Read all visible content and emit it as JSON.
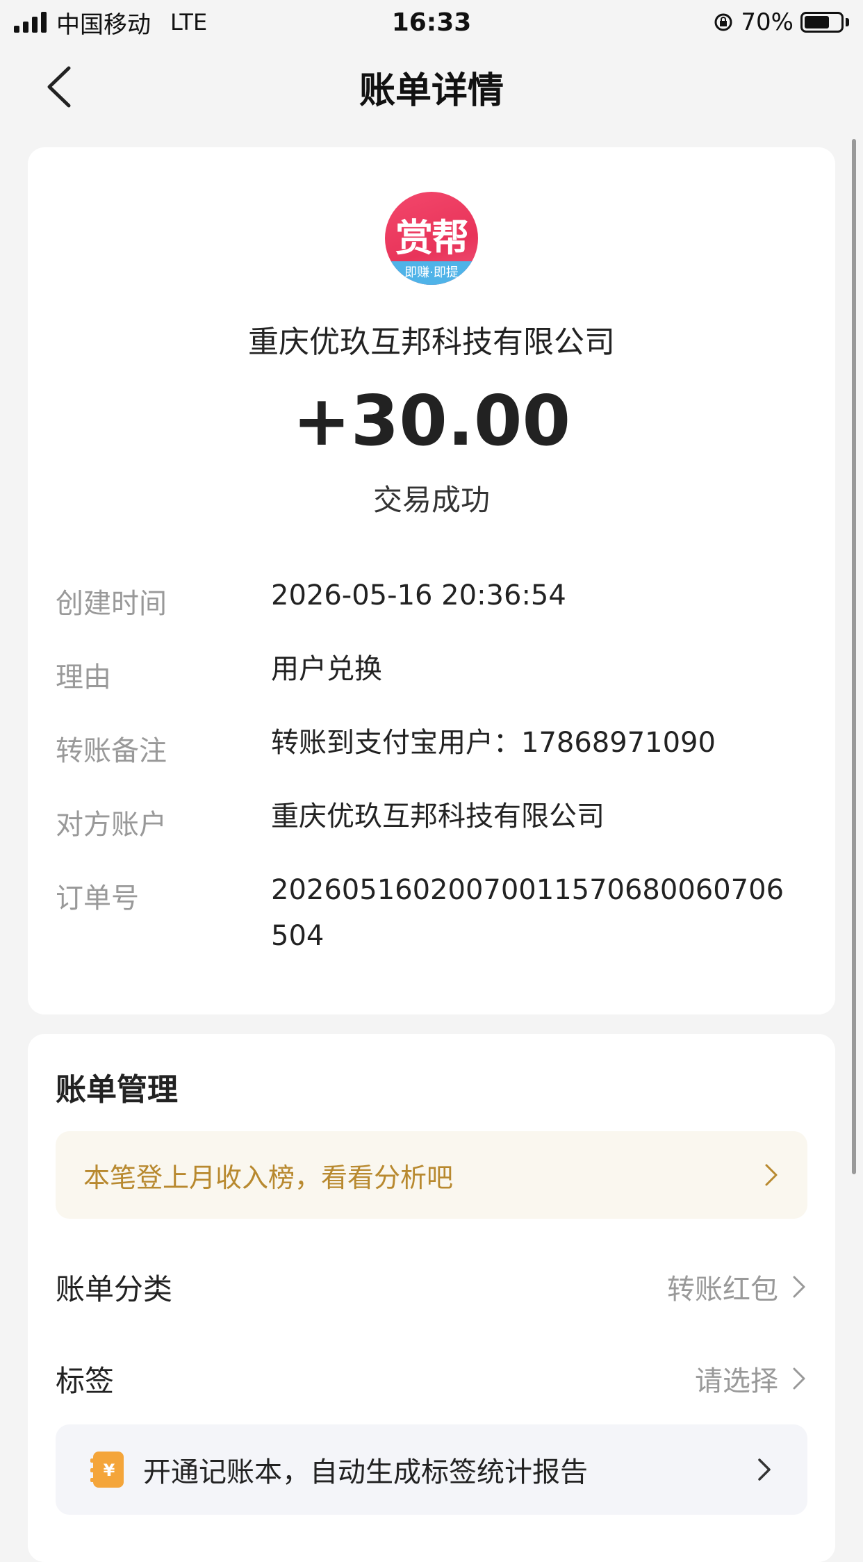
{
  "status_bar": {
    "carrier": "中国移动",
    "network": "LTE",
    "time": "16:33",
    "battery_percent": "70%",
    "battery_level": 0.7
  },
  "nav": {
    "title": "账单详情"
  },
  "bill": {
    "merchant_logo_text": "赏帮",
    "merchant_logo_subtext": "即赚·即提",
    "merchant_name": "重庆优玖互邦科技有限公司",
    "amount": "+30.00",
    "status": "交易成功",
    "details": [
      {
        "label": "创建时间",
        "value": "2026-05-16 20:36:54"
      },
      {
        "label": "理由",
        "value": "用户兑换"
      },
      {
        "label": "转账备注",
        "value": "转账到支付宝用户：17868971090"
      },
      {
        "label": "对方账户",
        "value": "重庆优玖互邦科技有限公司"
      },
      {
        "label": "订单号",
        "value": "20260516020070011570680060706504"
      }
    ]
  },
  "manage": {
    "title": "账单管理",
    "tip": "本笔登上月收入榜，看看分析吧",
    "category_label": "账单分类",
    "category_value": "转账红包",
    "tag_label": "标签",
    "tag_value": "请选择",
    "promo_text": "开通记账本，自动生成标签统计报告"
  },
  "colors": {
    "tip_text": "#b8892f",
    "logo": "#e8345a",
    "promo_icon": "#f4a53a"
  }
}
